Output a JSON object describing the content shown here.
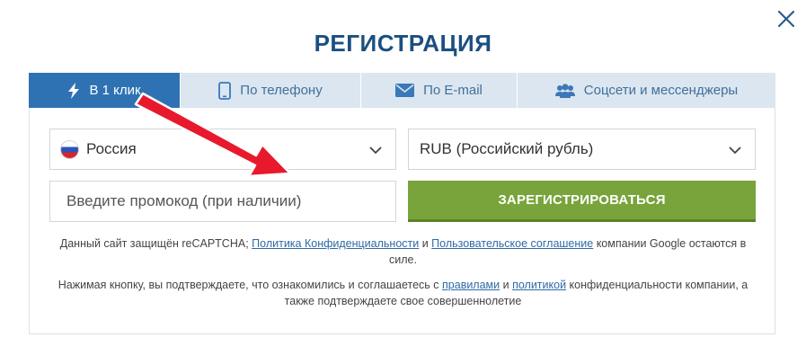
{
  "title": "РЕГИСТРАЦИЯ",
  "tabs": [
    {
      "label": "В 1 клик",
      "icon": "lightning-icon",
      "active": true
    },
    {
      "label": "По телефону",
      "icon": "phone-icon",
      "active": false
    },
    {
      "label": "По E-mail",
      "icon": "envelope-icon",
      "active": false
    },
    {
      "label": "Соцсети и мессенджеры",
      "icon": "users-icon",
      "active": false
    }
  ],
  "form": {
    "country": "Россия",
    "currency": "RUB (Российский рубль)",
    "promo_placeholder": "Введите промокод (при наличии)",
    "register_label": "ЗАРЕГИСТРИРОВАТЬСЯ"
  },
  "notice1": {
    "prefix": "Данный сайт защищён reCAPTCHA; ",
    "link1": "Политика Конфиденциальности",
    "and": " и ",
    "link2": "Пользовательское соглашение",
    "suffix": " компании Google остаются в силе."
  },
  "notice2": {
    "prefix": "Нажимая кнопку, вы подтверждаете, что ознакомились и соглашаетесь с ",
    "link1": "правилами",
    "and": " и ",
    "link2": "политикой",
    "suffix": " конфиденциальности компании, а также подтверждаете свое совершеннолетие"
  },
  "colors": {
    "title": "#1c4f80",
    "tab_active": "#2e72b3",
    "tab_inactive": "#dbe6f0",
    "button": "#78a43b",
    "link": "#2f6aa5",
    "arrow": "#e8192c"
  }
}
